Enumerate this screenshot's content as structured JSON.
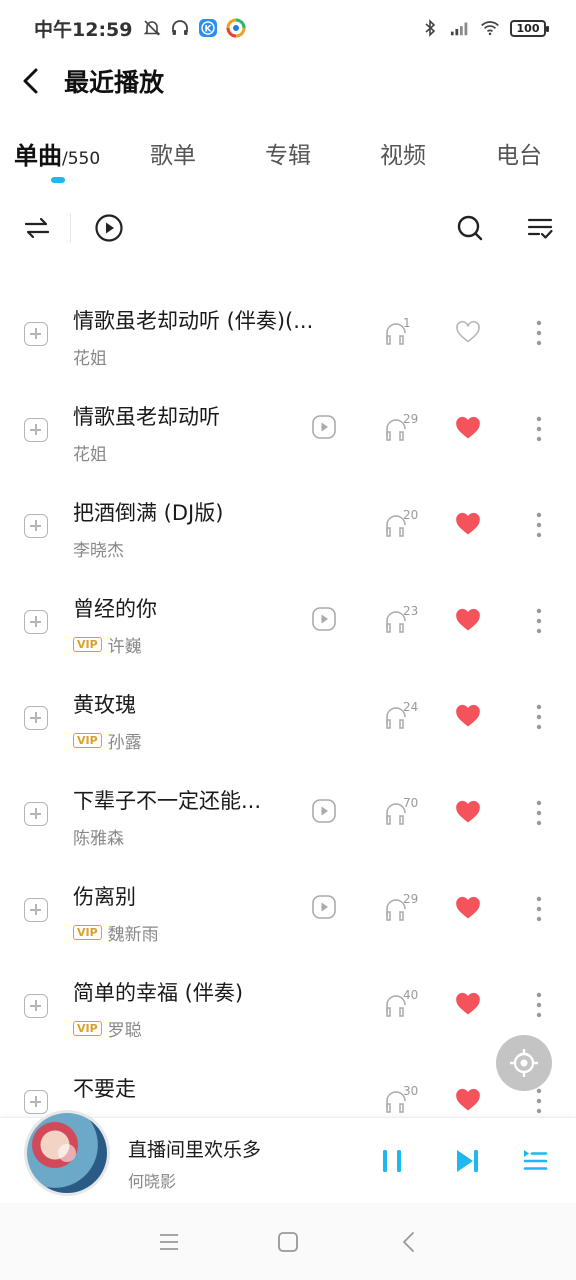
{
  "status_bar": {
    "time": "中午12:59",
    "battery": "100"
  },
  "header": {
    "title": "最近播放"
  },
  "tabs": [
    {
      "label": "单曲",
      "count": "/550"
    },
    {
      "label": "歌单"
    },
    {
      "label": "专辑"
    },
    {
      "label": "视频"
    },
    {
      "label": "电台"
    }
  ],
  "songs": [
    {
      "title": "情歌虽老却动听 (伴奏)(...",
      "artist": "花姐",
      "vip": "",
      "has_mv": false,
      "listens": "1",
      "liked": false
    },
    {
      "title": "情歌虽老却动听",
      "artist": "花姐",
      "vip": "",
      "has_mv": true,
      "listens": "29",
      "liked": true
    },
    {
      "title": "把酒倒满 (DJ版)",
      "artist": "李晓杰",
      "vip": "",
      "has_mv": false,
      "listens": "20",
      "liked": true
    },
    {
      "title": "曾经的你",
      "artist": "许巍",
      "vip": "VIP",
      "has_mv": true,
      "listens": "23",
      "liked": true
    },
    {
      "title": "黄玫瑰",
      "artist": "孙露",
      "vip": "VIP",
      "has_mv": false,
      "listens": "24",
      "liked": true
    },
    {
      "title": "下辈子不一定还能...",
      "artist": "陈雅森",
      "vip": "",
      "has_mv": true,
      "listens": "70",
      "liked": true
    },
    {
      "title": "伤离别",
      "artist": "魏新雨",
      "vip": "VIP",
      "has_mv": true,
      "listens": "29",
      "liked": true
    },
    {
      "title": "简单的幸福 (伴奏)",
      "artist": "罗聪",
      "vip": "VIP",
      "has_mv": false,
      "listens": "40",
      "liked": true
    },
    {
      "title": "不要走",
      "artist": "",
      "vip": "",
      "has_mv": false,
      "listens": "30",
      "liked": true
    }
  ],
  "now_playing": {
    "title": "直播间里欢乐多",
    "artist": "何晓影"
  },
  "colors": {
    "accent": "#1eb8f0",
    "like": "#f5525b",
    "vip": "#d9a12b"
  }
}
